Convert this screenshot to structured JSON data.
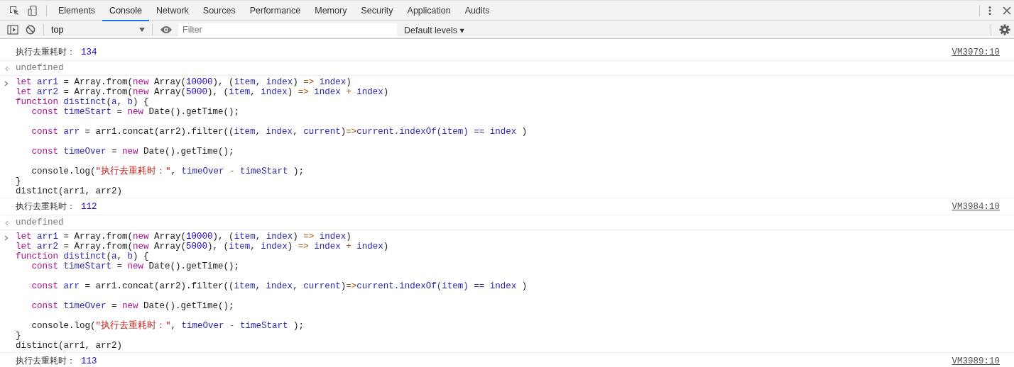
{
  "tabs": [
    {
      "label": "Elements",
      "selected": false
    },
    {
      "label": "Console",
      "selected": true
    },
    {
      "label": "Network",
      "selected": false
    },
    {
      "label": "Sources",
      "selected": false
    },
    {
      "label": "Performance",
      "selected": false
    },
    {
      "label": "Memory",
      "selected": false
    },
    {
      "label": "Security",
      "selected": false
    },
    {
      "label": "Application",
      "selected": false
    },
    {
      "label": "Audits",
      "selected": false
    }
  ],
  "console_toolbar": {
    "context": "top",
    "filter": {
      "placeholder": "Filter"
    },
    "levels": "Default levels ▾"
  },
  "entries": [
    {
      "kind": "log",
      "text": "执行去重耗时：",
      "value": "134",
      "source": "VM3979:10"
    },
    {
      "kind": "result",
      "text": "undefined"
    },
    {
      "kind": "input",
      "lines": [
        {
          "kind": "code",
          "tokens": [
            {
              "kind": "keyword",
              "text": "let"
            },
            {
              "kind": "variable",
              "text": " arr1"
            },
            {
              "kind": "plain",
              "text": " = Array.from("
            },
            {
              "kind": "keyword",
              "text": "new"
            },
            {
              "kind": "plain",
              "text": " Array("
            },
            {
              "kind": "number",
              "text": "10000"
            },
            {
              "kind": "plain",
              "text": "), ("
            },
            {
              "kind": "variable",
              "text": "item"
            },
            {
              "kind": "plain",
              "text": ", "
            },
            {
              "kind": "variable",
              "text": "index"
            },
            {
              "kind": "plain",
              "text": ") "
            },
            {
              "kind": "operator",
              "text": "=>"
            },
            {
              "kind": "variable",
              "text": " index"
            },
            {
              "kind": "plain",
              "text": ")"
            }
          ]
        },
        {
          "kind": "code",
          "tokens": [
            {
              "kind": "keyword",
              "text": "let"
            },
            {
              "kind": "variable",
              "text": " arr2"
            },
            {
              "kind": "plain",
              "text": " = Array.from("
            },
            {
              "kind": "keyword",
              "text": "new"
            },
            {
              "kind": "plain",
              "text": " Array("
            },
            {
              "kind": "number",
              "text": "5000"
            },
            {
              "kind": "plain",
              "text": "), ("
            },
            {
              "kind": "variable",
              "text": "item"
            },
            {
              "kind": "plain",
              "text": ", "
            },
            {
              "kind": "variable",
              "text": "index"
            },
            {
              "kind": "plain",
              "text": ") "
            },
            {
              "kind": "operator",
              "text": "=>"
            },
            {
              "kind": "variable",
              "text": " index"
            },
            {
              "kind": "operator",
              "text": " +"
            },
            {
              "kind": "variable",
              "text": " index"
            },
            {
              "kind": "plain",
              "text": ")"
            }
          ]
        },
        {
          "kind": "code",
          "tokens": [
            {
              "kind": "keyword",
              "text": "function"
            },
            {
              "kind": "variable",
              "text": " distinct"
            },
            {
              "kind": "plain",
              "text": "("
            },
            {
              "kind": "variable",
              "text": "a"
            },
            {
              "kind": "plain",
              "text": ", "
            },
            {
              "kind": "variable",
              "text": "b"
            },
            {
              "kind": "plain",
              "text": ") {"
            }
          ]
        },
        {
          "kind": "code",
          "tokens": [
            {
              "kind": "keyword",
              "text": "   const"
            },
            {
              "kind": "variable",
              "text": " timeStart"
            },
            {
              "kind": "plain",
              "text": " = "
            },
            {
              "kind": "keyword",
              "text": "new"
            },
            {
              "kind": "plain",
              "text": " Date().getTime();"
            }
          ]
        },
        {
          "kind": "blank"
        },
        {
          "kind": "code",
          "tokens": [
            {
              "kind": "keyword",
              "text": "   const"
            },
            {
              "kind": "variable",
              "text": " arr"
            },
            {
              "kind": "plain",
              "text": " = arr1.concat(arr2).filter(("
            },
            {
              "kind": "variable",
              "text": "item"
            },
            {
              "kind": "plain",
              "text": ", "
            },
            {
              "kind": "variable",
              "text": "index"
            },
            {
              "kind": "plain",
              "text": ", "
            },
            {
              "kind": "variable",
              "text": "current"
            },
            {
              "kind": "plain",
              "text": ")"
            },
            {
              "kind": "operator",
              "text": "=>"
            },
            {
              "kind": "variable",
              "text": "current.indexOf(item) == index"
            },
            {
              "kind": "plain",
              "text": " )"
            }
          ]
        },
        {
          "kind": "blank"
        },
        {
          "kind": "code",
          "tokens": [
            {
              "kind": "keyword",
              "text": "   const"
            },
            {
              "kind": "variable",
              "text": " timeOver"
            },
            {
              "kind": "plain",
              "text": " = "
            },
            {
              "kind": "keyword",
              "text": "new"
            },
            {
              "kind": "plain",
              "text": " Date().getTime();"
            }
          ]
        },
        {
          "kind": "blank"
        },
        {
          "kind": "code",
          "tokens": [
            {
              "kind": "plain",
              "text": "   console.log("
            },
            {
              "kind": "string",
              "text": "\"执行去重耗时：\""
            },
            {
              "kind": "plain",
              "text": ", "
            },
            {
              "kind": "variable",
              "text": "timeOver"
            },
            {
              "kind": "operator",
              "text": " -"
            },
            {
              "kind": "variable",
              "text": " timeStart"
            },
            {
              "kind": "plain",
              "text": " );"
            }
          ]
        },
        {
          "kind": "code",
          "tokens": [
            {
              "kind": "plain",
              "text": "}"
            }
          ]
        },
        {
          "kind": "code",
          "tokens": [
            {
              "kind": "plain",
              "text": "distinct(arr1, arr2)"
            }
          ]
        }
      ]
    },
    {
      "kind": "log",
      "text": "执行去重耗时：",
      "value": "112",
      "source": "VM3984:10"
    },
    {
      "kind": "result",
      "text": "undefined"
    },
    {
      "kind": "input",
      "lines": [
        {
          "kind": "code",
          "tokens": [
            {
              "kind": "keyword",
              "text": "let"
            },
            {
              "kind": "variable",
              "text": " arr1"
            },
            {
              "kind": "plain",
              "text": " = Array.from("
            },
            {
              "kind": "keyword",
              "text": "new"
            },
            {
              "kind": "plain",
              "text": " Array("
            },
            {
              "kind": "number",
              "text": "10000"
            },
            {
              "kind": "plain",
              "text": "), ("
            },
            {
              "kind": "variable",
              "text": "item"
            },
            {
              "kind": "plain",
              "text": ", "
            },
            {
              "kind": "variable",
              "text": "index"
            },
            {
              "kind": "plain",
              "text": ") "
            },
            {
              "kind": "operator",
              "text": "=>"
            },
            {
              "kind": "variable",
              "text": " index"
            },
            {
              "kind": "plain",
              "text": ")"
            }
          ]
        },
        {
          "kind": "code",
          "tokens": [
            {
              "kind": "keyword",
              "text": "let"
            },
            {
              "kind": "variable",
              "text": " arr2"
            },
            {
              "kind": "plain",
              "text": " = Array.from("
            },
            {
              "kind": "keyword",
              "text": "new"
            },
            {
              "kind": "plain",
              "text": " Array("
            },
            {
              "kind": "number",
              "text": "5000"
            },
            {
              "kind": "plain",
              "text": "), ("
            },
            {
              "kind": "variable",
              "text": "item"
            },
            {
              "kind": "plain",
              "text": ", "
            },
            {
              "kind": "variable",
              "text": "index"
            },
            {
              "kind": "plain",
              "text": ") "
            },
            {
              "kind": "operator",
              "text": "=>"
            },
            {
              "kind": "variable",
              "text": " index"
            },
            {
              "kind": "operator",
              "text": " +"
            },
            {
              "kind": "variable",
              "text": " index"
            },
            {
              "kind": "plain",
              "text": ")"
            }
          ]
        },
        {
          "kind": "code",
          "tokens": [
            {
              "kind": "keyword",
              "text": "function"
            },
            {
              "kind": "variable",
              "text": " distinct"
            },
            {
              "kind": "plain",
              "text": "("
            },
            {
              "kind": "variable",
              "text": "a"
            },
            {
              "kind": "plain",
              "text": ", "
            },
            {
              "kind": "variable",
              "text": "b"
            },
            {
              "kind": "plain",
              "text": ") {"
            }
          ]
        },
        {
          "kind": "code",
          "tokens": [
            {
              "kind": "keyword",
              "text": "   const"
            },
            {
              "kind": "variable",
              "text": " timeStart"
            },
            {
              "kind": "plain",
              "text": " = "
            },
            {
              "kind": "keyword",
              "text": "new"
            },
            {
              "kind": "plain",
              "text": " Date().getTime();"
            }
          ]
        },
        {
          "kind": "blank"
        },
        {
          "kind": "code",
          "tokens": [
            {
              "kind": "keyword",
              "text": "   const"
            },
            {
              "kind": "variable",
              "text": " arr"
            },
            {
              "kind": "plain",
              "text": " = arr1.concat(arr2).filter(("
            },
            {
              "kind": "variable",
              "text": "item"
            },
            {
              "kind": "plain",
              "text": ", "
            },
            {
              "kind": "variable",
              "text": "index"
            },
            {
              "kind": "plain",
              "text": ", "
            },
            {
              "kind": "variable",
              "text": "current"
            },
            {
              "kind": "plain",
              "text": ")"
            },
            {
              "kind": "operator",
              "text": "=>"
            },
            {
              "kind": "variable",
              "text": "current.indexOf(item) == index"
            },
            {
              "kind": "plain",
              "text": " )"
            }
          ]
        },
        {
          "kind": "blank"
        },
        {
          "kind": "code",
          "tokens": [
            {
              "kind": "keyword",
              "text": "   const"
            },
            {
              "kind": "variable",
              "text": " timeOver"
            },
            {
              "kind": "plain",
              "text": " = "
            },
            {
              "kind": "keyword",
              "text": "new"
            },
            {
              "kind": "plain",
              "text": " Date().getTime();"
            }
          ]
        },
        {
          "kind": "blank"
        },
        {
          "kind": "code",
          "tokens": [
            {
              "kind": "plain",
              "text": "   console.log("
            },
            {
              "kind": "string",
              "text": "\"执行去重耗时：\""
            },
            {
              "kind": "plain",
              "text": ", "
            },
            {
              "kind": "variable",
              "text": "timeOver"
            },
            {
              "kind": "operator",
              "text": " -"
            },
            {
              "kind": "variable",
              "text": " timeStart"
            },
            {
              "kind": "plain",
              "text": " );"
            }
          ]
        },
        {
          "kind": "code",
          "tokens": [
            {
              "kind": "plain",
              "text": "}"
            }
          ]
        },
        {
          "kind": "code",
          "tokens": [
            {
              "kind": "plain",
              "text": "distinct(arr1, arr2)"
            }
          ]
        }
      ]
    },
    {
      "kind": "log",
      "text": "执行去重耗时：",
      "value": "113",
      "source": "VM3989:10"
    }
  ]
}
